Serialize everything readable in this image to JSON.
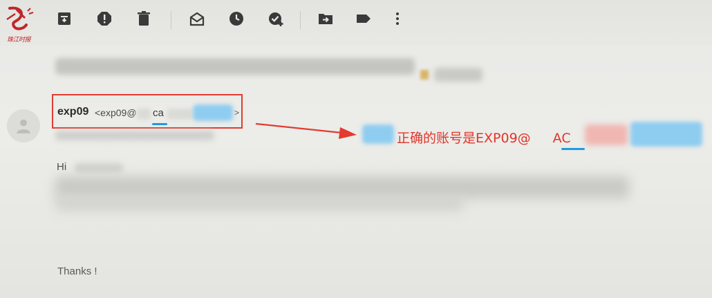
{
  "logo": {
    "caption": "珠江时报",
    "icon": "newspaper-brand-logo"
  },
  "toolbar": {
    "buttons": [
      {
        "icon": "archive-icon"
      },
      {
        "icon": "report-spam-icon"
      },
      {
        "icon": "delete-icon"
      },
      {
        "icon": "mark-as-read-icon"
      },
      {
        "icon": "snooze-clock-icon"
      },
      {
        "icon": "add-to-tasks-icon"
      },
      {
        "icon": "move-to-icon"
      },
      {
        "icon": "label-icon"
      },
      {
        "icon": "more-vertical-icon"
      }
    ]
  },
  "email": {
    "sender_name": "exp09",
    "sender_email_prefix": "<exp09@",
    "sender_domain_visible": "ca",
    "sender_email_suffix": ">",
    "greeting": "Hi",
    "signoff": "Thanks !"
  },
  "annotation": {
    "note_text": "正确的账号是EXP09@",
    "note_highlight": "AC",
    "box_color": "#e23b2f",
    "arrow_color": "#e23b2f",
    "underline_color": "#1e9be0"
  }
}
